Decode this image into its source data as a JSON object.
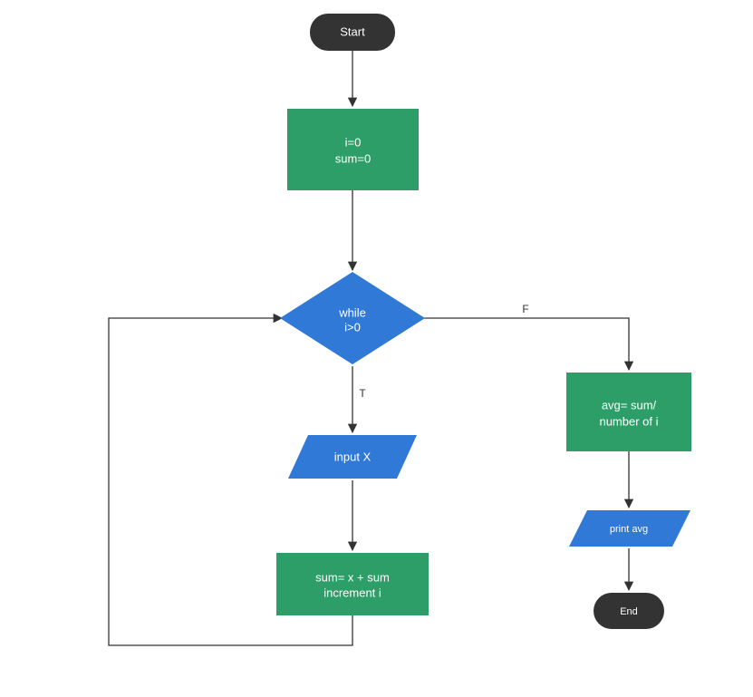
{
  "nodes": {
    "start": {
      "label": "Start"
    },
    "init": {
      "line1": "i=0",
      "line2": "sum=0"
    },
    "decision": {
      "line1": "while",
      "line2": "i>0"
    },
    "inputx": {
      "label": "input X"
    },
    "sumblock": {
      "line1": "sum= x + sum",
      "line2": "increment i"
    },
    "avgblock": {
      "line1": "avg= sum/",
      "line2": "number of i"
    },
    "printavg": {
      "label": "print avg"
    },
    "end": {
      "label": "End"
    }
  },
  "edges": {
    "true_label": "T",
    "false_label": "F"
  },
  "chart_data": {
    "type": "flowchart",
    "nodes": [
      {
        "id": "start",
        "shape": "terminator",
        "text": "Start"
      },
      {
        "id": "init",
        "shape": "process",
        "text": "i=0\nsum=0"
      },
      {
        "id": "decision",
        "shape": "decision",
        "text": "while\ni>0"
      },
      {
        "id": "inputx",
        "shape": "io",
        "text": "input X"
      },
      {
        "id": "sumblock",
        "shape": "process",
        "text": "sum= x + sum\nincrement i"
      },
      {
        "id": "avgblock",
        "shape": "process",
        "text": "avg= sum/\nnumber of i"
      },
      {
        "id": "printavg",
        "shape": "io",
        "text": "print avg"
      },
      {
        "id": "end",
        "shape": "terminator",
        "text": "End"
      }
    ],
    "edges": [
      {
        "from": "start",
        "to": "init"
      },
      {
        "from": "init",
        "to": "decision"
      },
      {
        "from": "decision",
        "to": "inputx",
        "label": "T"
      },
      {
        "from": "inputx",
        "to": "sumblock"
      },
      {
        "from": "sumblock",
        "to": "decision"
      },
      {
        "from": "decision",
        "to": "avgblock",
        "label": "F"
      },
      {
        "from": "avgblock",
        "to": "printavg"
      },
      {
        "from": "printavg",
        "to": "end"
      }
    ]
  }
}
